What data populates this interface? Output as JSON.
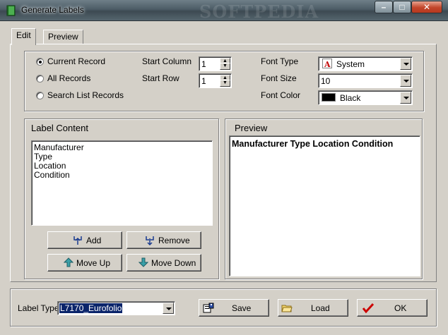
{
  "window": {
    "title": "Generate Labels",
    "watermark": "SOFTPEDIA"
  },
  "tabs": [
    {
      "label": "Edit",
      "active": true
    },
    {
      "label": "Preview",
      "active": false
    }
  ],
  "record_options": {
    "items": [
      {
        "label": "Current Record",
        "selected": true
      },
      {
        "label": "All Records",
        "selected": false
      },
      {
        "label": "Search List Records",
        "selected": false
      }
    ]
  },
  "position": {
    "start_column_label": "Start Column",
    "start_column_value": "1",
    "start_row_label": "Start Row",
    "start_row_value": "1"
  },
  "font": {
    "type_label": "Font Type",
    "type_value": "System",
    "size_label": "Font Size",
    "size_value": "10",
    "color_label": "Font Color",
    "color_value": "Black",
    "color_swatch": "#000000"
  },
  "label_content": {
    "title": "Label Content",
    "items": [
      "Manufacturer",
      "Type",
      "Location",
      "Condition"
    ],
    "add_label": "Add",
    "remove_label": "Remove",
    "move_up_label": "Move Up",
    "move_down_label": "Move Down"
  },
  "preview": {
    "title": "Preview",
    "text": "Manufacturer Type Location Condition"
  },
  "footer": {
    "label_type_label": "Label Type",
    "label_type_value": "L7170_Eurofolio",
    "save_label": "Save",
    "load_label": "Load",
    "ok_label": "OK"
  },
  "colors": {
    "face": "#d4d0c8",
    "selection": "#0a246a",
    "ok_check": "#cc0000"
  }
}
